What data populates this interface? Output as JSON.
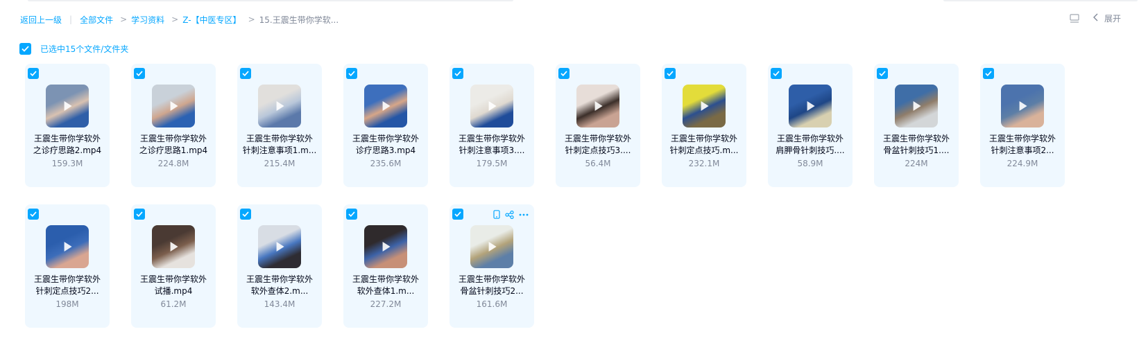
{
  "breadcrumb": {
    "back": "返回上一级",
    "items": [
      "全部文件",
      "学习资料",
      "Z-【中医专区】"
    ],
    "current": "15.王震生带你学软...",
    "separator": ">"
  },
  "toolbar": {
    "expand_label": "展开"
  },
  "selection": {
    "label": "已选中15个文件/文件夹"
  },
  "colors": {
    "accent": "#06a7ff",
    "card_bg": "#eff8ff"
  },
  "files": [
    {
      "name_line1": "王震生带你学软外",
      "name_line2": "之诊疗思路2.mp4",
      "size": "159.3M",
      "thumb": [
        "#7c93b3",
        "#2f5fa8",
        "#d9c2b1"
      ]
    },
    {
      "name_line1": "王震生带你学软外",
      "name_line2": "之诊疗思路1.mp4",
      "size": "224.8M",
      "thumb": [
        "#c9d1d9",
        "#2b62b3",
        "#cfa68e"
      ]
    },
    {
      "name_line1": "王震生带你学软外",
      "name_line2": "针刺注意事项1.m...",
      "size": "215.4M",
      "thumb": [
        "#e1dfdc",
        "#5b79aa",
        "#b9c7da"
      ]
    },
    {
      "name_line1": "王震生带你学软外",
      "name_line2": "诊疗思路3.mp4",
      "size": "235.6M",
      "thumb": [
        "#3d6fbd",
        "#2456a6",
        "#d7a688"
      ]
    },
    {
      "name_line1": "王震生带你学软外",
      "name_line2": "针刺注意事项3....",
      "size": "179.5M",
      "thumb": [
        "#ecebe7",
        "#1f4c9a",
        "#dfd9d0"
      ]
    },
    {
      "name_line1": "王震生带你学软外",
      "name_line2": "针刺定点技巧3....",
      "size": "56.4M",
      "thumb": [
        "#e7ddd8",
        "#c9a393",
        "#3c2f2a"
      ]
    },
    {
      "name_line1": "王震生带你学软外",
      "name_line2": "针刺定点技巧.m...",
      "size": "232.1M",
      "thumb": [
        "#e3dc3a",
        "#7a6a45",
        "#2c4f8f"
      ]
    },
    {
      "name_line1": "王震生带你学软外",
      "name_line2": "肩胛骨针刺技巧....",
      "size": "58.9M",
      "thumb": [
        "#2e5ea8",
        "#d8d0b0",
        "#1e4686"
      ]
    },
    {
      "name_line1": "王震生带你学软外",
      "name_line2": "骨盆针刺技巧1....",
      "size": "224M",
      "thumb": [
        "#3f6ea7",
        "#d3d6d8",
        "#8f7d6a"
      ]
    },
    {
      "name_line1": "王震生带你学软外",
      "name_line2": "针刺注意事项2...",
      "size": "224.9M",
      "thumb": [
        "#4c73ad",
        "#d9b29a",
        "#5c7ea6"
      ]
    },
    {
      "name_line1": "王震生带你学软外",
      "name_line2": "针刺定点技巧2...",
      "size": "198M",
      "thumb": [
        "#2b5ead",
        "#d9a691",
        "#3c6dba"
      ]
    },
    {
      "name_line1": "王震生带你学软外",
      "name_line2": "试播.mp4",
      "size": "61.2M",
      "thumb": [
        "#4a3a33",
        "#e6e2de",
        "#7b5e4c"
      ]
    },
    {
      "name_line1": "王震生带你学软外",
      "name_line2": "软外查体2.m...",
      "size": "143.4M",
      "thumb": [
        "#d8dde4",
        "#2e2c32",
        "#4877c0"
      ]
    },
    {
      "name_line1": "王震生带你学软外",
      "name_line2": "软外查体1.m...",
      "size": "227.2M",
      "thumb": [
        "#2f2a2c",
        "#c79077",
        "#3d63a8"
      ]
    },
    {
      "name_line1": "王震生带你学软外",
      "name_line2": "骨盆针刺技巧2...",
      "size": "161.6M",
      "thumb": [
        "#e9ece7",
        "#5d7fa8",
        "#b3a37a"
      ]
    }
  ],
  "card_actions": [
    "phone-icon",
    "share-icon",
    "more-icon"
  ]
}
